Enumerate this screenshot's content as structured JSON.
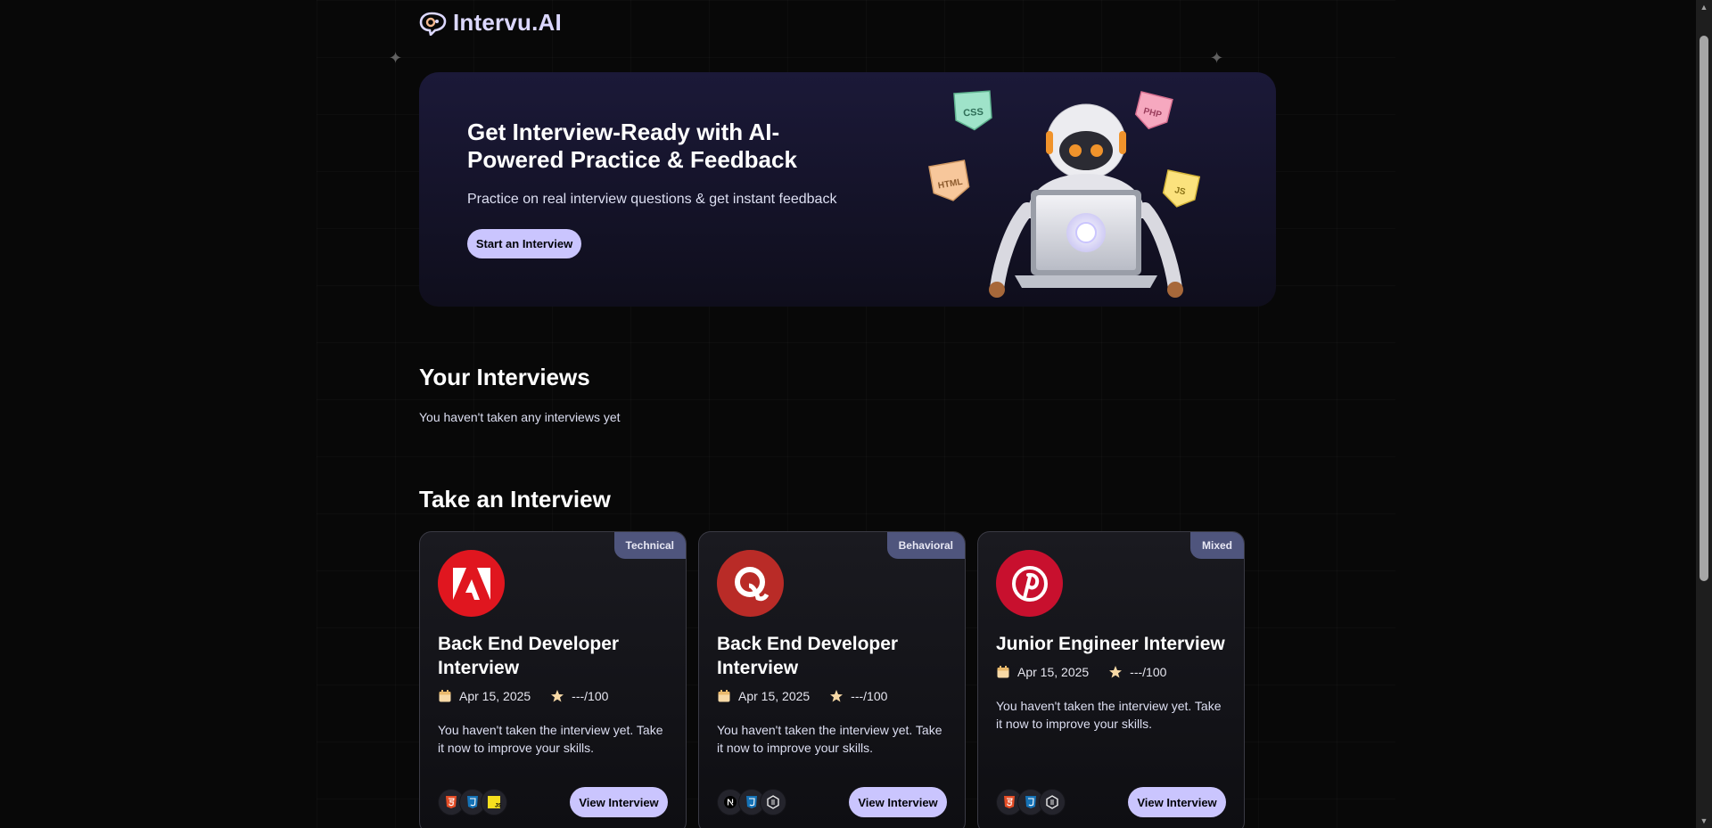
{
  "app": {
    "name": "Intervu.AI",
    "logo_icon": "chat-bubble-icon"
  },
  "hero": {
    "title": "Get Interview-Ready with AI-Powered Practice & Feedback",
    "subtitle": "Practice on real interview questions & get instant feedback",
    "cta_label": "Start an Interview",
    "tags": [
      "CSS",
      "PHP",
      "HTML",
      "JS"
    ]
  },
  "your_interviews": {
    "title": "Your Interviews",
    "empty_text": "You haven't taken any interviews yet"
  },
  "take_interview": {
    "title": "Take an Interview",
    "cards": [
      {
        "badge": "Technical",
        "company_icon": "adobe-logo-icon",
        "company_color": "#e0161f",
        "title": "Back End Developer Interview",
        "date": "Apr 15, 2025",
        "score": "---/100",
        "description": "You haven't taken the interview yet. Take it now to improve your skills.",
        "tech_icons": [
          "html5-icon",
          "css3-icon",
          "javascript-icon"
        ],
        "button_label": "View Interview"
      },
      {
        "badge": "Behavioral",
        "company_icon": "quora-logo-icon",
        "company_color": "#b92b27",
        "title": "Back End Developer Interview",
        "date": "Apr 15, 2025",
        "score": "---/100",
        "description": "You haven't taken the interview yet. Take it now to improve your skills.",
        "tech_icons": [
          "nextjs-icon",
          "css3-icon",
          "nodejs-icon"
        ],
        "button_label": "View Interview"
      },
      {
        "badge": "Mixed",
        "company_icon": "pinterest-logo-icon",
        "company_color": "#c8102e",
        "title": "Junior Engineer Interview",
        "date": "Apr 15, 2025",
        "score": "---/100",
        "description": "You haven't taken the interview yet. Take it now to improve your skills.",
        "tech_icons": [
          "html5-icon",
          "css3-icon",
          "nodejs-icon"
        ],
        "button_label": "View Interview"
      }
    ]
  },
  "colors": {
    "background": "#080808",
    "accent": "#cac5fe",
    "badge": "#4f557d",
    "hero_gradient_top": "#1b1938"
  }
}
